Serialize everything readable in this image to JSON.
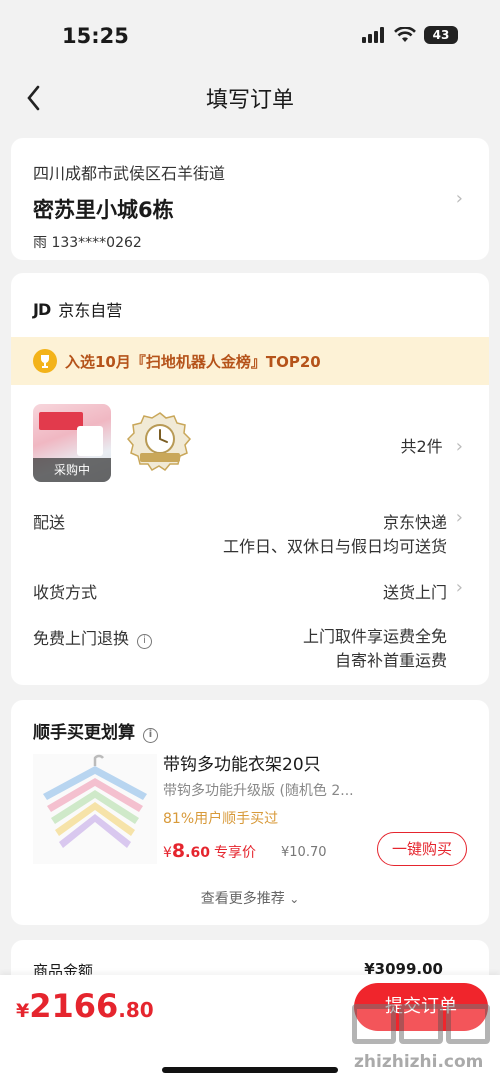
{
  "status": {
    "time": "15:25",
    "battery": "43"
  },
  "nav": {
    "title": "填写订单"
  },
  "address": {
    "region": "四川成都市武侯区石羊街道",
    "detail": "密苏里小城6栋",
    "contact": "雨  133****0262"
  },
  "order": {
    "shop_logo": "JD",
    "shop_name": "京东自营",
    "rank_banner": "入选10月『扫地机器人金榜』TOP20",
    "thumb_badge": "采购中",
    "item_count": "共2件",
    "delivery_label": "配送",
    "delivery_value": "京东快递",
    "delivery_note": "工作日、双休日与假日均可送货",
    "receive_label": "收货方式",
    "receive_value": "送货上门",
    "return_label": "免费上门退换",
    "return_value_line1": "上门取件享运费全免",
    "return_value_line2": "自寄补首重运费"
  },
  "recommend": {
    "title": "顺手买更划算",
    "product_name": "带钩多功能衣架20只",
    "product_spec": "带钩多功能升级版 (随机色 2...",
    "buy_rate": "81%用户顺手买过",
    "price_symbol": "¥",
    "price_int": "8",
    "price_dec": ".60",
    "price_tag": "专享价",
    "original_price": "¥10.70",
    "buy_button": "一键购买",
    "more_label": "查看更多推荐"
  },
  "amount": {
    "label": "商品金额",
    "value": "¥3099.00"
  },
  "footer": {
    "total_symbol": "¥",
    "total_int": "2166",
    "total_dec": ".80",
    "submit_label": "提交订单"
  },
  "watermark": {
    "text": "zhizhizhi.com"
  },
  "colors": {
    "accent": "#e5252e",
    "banner_bg": "#fdf2d6",
    "banner_text": "#b5531a",
    "gold": "#f3b31a"
  }
}
